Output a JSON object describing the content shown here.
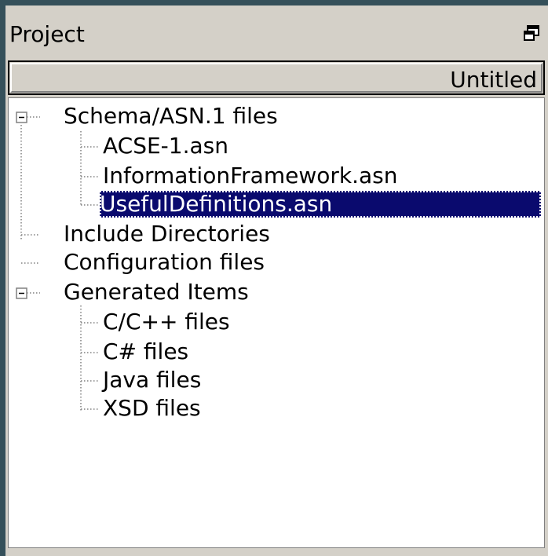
{
  "panel": {
    "title": "Project",
    "float_icon": "restore-window-icon",
    "header_label": "Untitled"
  },
  "tree": {
    "schema_group": "Schema/ASN.1 files",
    "schema_items": [
      "ACSE-1.asn",
      "InformationFramework.asn",
      "UsefulDefinitions.asn"
    ],
    "include_dirs": "Include Directories",
    "config_files": "Configuration files",
    "generated_group": "Generated Items",
    "generated_items": [
      "C/C++ files",
      "C# files",
      "Java files",
      "XSD files"
    ]
  },
  "colors": {
    "selection_bg": "#0a0a6e",
    "frame_dark": "#35505a",
    "chrome": "#d4d0c8"
  }
}
